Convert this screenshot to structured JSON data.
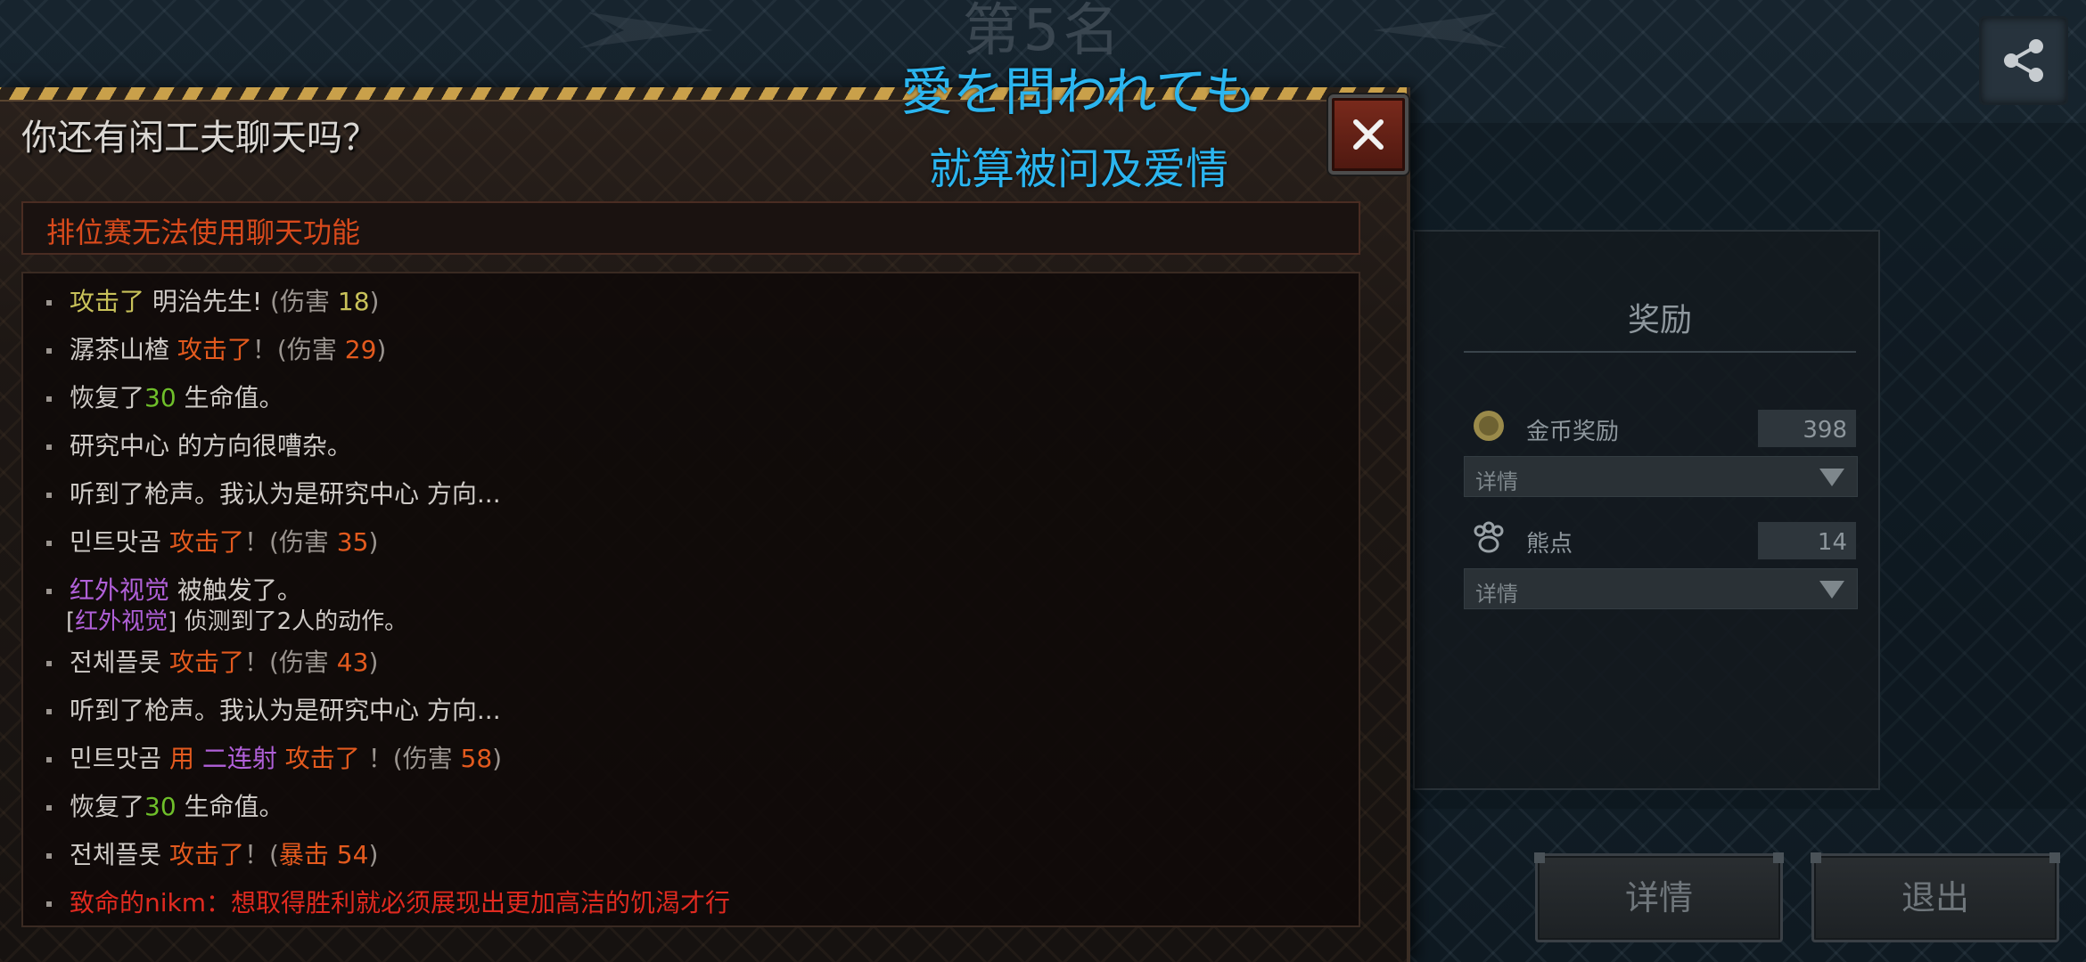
{
  "background": {
    "rank_text": "第5名",
    "reward_panel": {
      "title": "奖励",
      "gold": {
        "label": "金币奖励",
        "value": "398",
        "icon": "coin-icon",
        "detail": "详情"
      },
      "bear": {
        "label": "熊点",
        "value": "14",
        "icon": "bear-paw-icon",
        "detail": "详情"
      }
    },
    "buttons": {
      "details": "详情",
      "exit": "退出"
    }
  },
  "dialog": {
    "title": "你还有闲工夫聊天吗？",
    "notice": "排位赛无法使用聊天功能",
    "log": [
      {
        "parts": [
          {
            "t": "攻击了",
            "c": "yellow"
          },
          {
            "t": " 明治先生! ",
            "c": "white"
          },
          {
            "t": "(伤害 ",
            "c": "grey"
          },
          {
            "t": "18",
            "c": "yellow"
          },
          {
            "t": ")",
            "c": "grey"
          }
        ]
      },
      {
        "parts": [
          {
            "t": "潺茶山楂  ",
            "c": "white"
          },
          {
            "t": "攻击了",
            "c": "orange"
          },
          {
            "t": "！(伤害 ",
            "c": "grey"
          },
          {
            "t": "29",
            "c": "orange"
          },
          {
            "t": ")",
            "c": "grey"
          }
        ]
      },
      {
        "parts": [
          {
            "t": "恢复了",
            "c": "white"
          },
          {
            "t": "30",
            "c": "green"
          },
          {
            "t": " 生命值。",
            "c": "white"
          }
        ]
      },
      {
        "parts": [
          {
            "t": "研究中心 的方向很嘈杂。",
            "c": "white"
          }
        ]
      },
      {
        "parts": [
          {
            "t": "听到了枪声。我认为是研究中心 方向...",
            "c": "white"
          }
        ]
      },
      {
        "parts": [
          {
            "t": "민트맛곰  ",
            "c": "white"
          },
          {
            "t": "攻击了",
            "c": "orange"
          },
          {
            "t": "！(伤害 ",
            "c": "grey"
          },
          {
            "t": "35",
            "c": "orange"
          },
          {
            "t": ")",
            "c": "grey"
          }
        ]
      },
      {
        "parts": [
          {
            "t": "红外视觉",
            "c": "purple"
          },
          {
            "t": " 被触发了。",
            "c": "white"
          }
        ],
        "sub": [
          {
            "t": "[",
            "c": "white"
          },
          {
            "t": "红外视觉",
            "c": "purple"
          },
          {
            "t": "] 侦测到了2人的动作。",
            "c": "white"
          }
        ]
      },
      {
        "parts": [
          {
            "t": "전체플롯  ",
            "c": "white"
          },
          {
            "t": "攻击了",
            "c": "orange"
          },
          {
            "t": "！(伤害 ",
            "c": "grey"
          },
          {
            "t": "43",
            "c": "orange"
          },
          {
            "t": ")",
            "c": "grey"
          }
        ]
      },
      {
        "parts": [
          {
            "t": "听到了枪声。我认为是研究中心 方向...",
            "c": "white"
          }
        ]
      },
      {
        "parts": [
          {
            "t": "민트맛곰  ",
            "c": "white"
          },
          {
            "t": "用 ",
            "c": "orange"
          },
          {
            "t": "二连射",
            "c": "purple"
          },
          {
            "t": " 攻击了 ",
            "c": "orange"
          },
          {
            "t": " ！(伤害 ",
            "c": "grey"
          },
          {
            "t": "58",
            "c": "orange"
          },
          {
            "t": ")",
            "c": "grey"
          }
        ]
      },
      {
        "parts": [
          {
            "t": "恢复了",
            "c": "white"
          },
          {
            "t": "30",
            "c": "green"
          },
          {
            "t": " 生命值。",
            "c": "white"
          }
        ]
      },
      {
        "parts": [
          {
            "t": "전체플롯  ",
            "c": "white"
          },
          {
            "t": "攻击了",
            "c": "orange"
          },
          {
            "t": "！(",
            "c": "grey"
          },
          {
            "t": "暴击 54",
            "c": "orange"
          },
          {
            "t": ")",
            "c": "grey"
          }
        ]
      },
      {
        "parts": [
          {
            "t": "致命的nikm：想取得胜利就必须展现出更加高洁的饥渴才行",
            "c": "red"
          }
        ]
      }
    ]
  },
  "lyrics": {
    "japanese": "愛を問われても",
    "chinese": "就算被问及爱情"
  },
  "icons": {
    "share": "share-icon",
    "close": "close-icon"
  },
  "colors": {
    "lyric": "#2bb5ef",
    "notice": "#d84a1c",
    "damage": "#e35a1e",
    "heal": "#6fbf2a",
    "skill": "#b060d8"
  }
}
